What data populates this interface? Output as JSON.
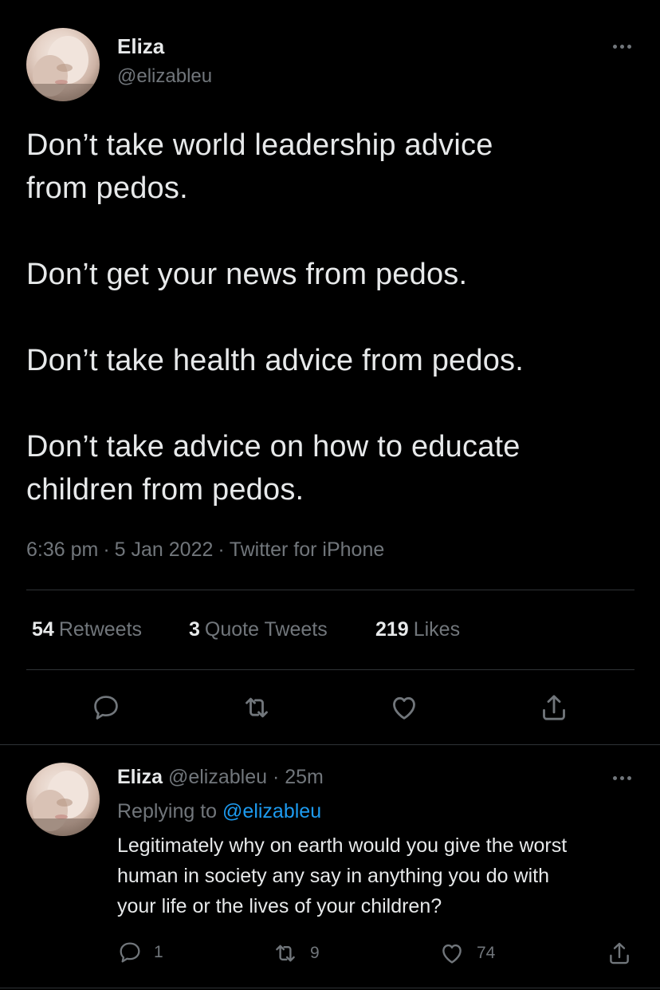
{
  "tweet": {
    "author_name": "Eliza",
    "author_handle": "@elizableu",
    "lines": [
      "Don’t take world leadership advice",
      "from pedos.",
      "Don’t get your news from pedos.",
      "Don’t take health advice from pedos.",
      "Don’t take advice on how to educate",
      "children from pedos."
    ],
    "time": "6:36 pm",
    "date": "5 Jan 2022",
    "source": "Twitter for iPhone",
    "separator": "·",
    "stats": {
      "retweets_count": "54",
      "retweets_label": "Retweets",
      "quotes_count": "3",
      "quotes_label": "Quote Tweets",
      "likes_count": "219",
      "likes_label": "Likes"
    }
  },
  "reply": {
    "author_name": "Eliza",
    "author_handle": "@elizableu",
    "time_ago": "25m",
    "separator": "·",
    "replying_prefix": "Replying to",
    "replying_to": "@elizableu",
    "lines": [
      "Legitimately why on earth would you give the worst",
      "human in society any say in anything you do with",
      "your life or the lives of your children?"
    ],
    "counts": {
      "replies": "1",
      "retweets": "9",
      "likes": "74"
    }
  },
  "colors": {
    "background": "#000000",
    "text_primary": "#e7e9ea",
    "text_secondary": "#71767b",
    "divider": "#2f3336",
    "link": "#1d9bf0"
  },
  "icons": {
    "more": "more-horizontal-icon",
    "reply": "comment-icon",
    "retweet": "retweet-icon",
    "like": "heart-icon",
    "share": "share-icon"
  }
}
